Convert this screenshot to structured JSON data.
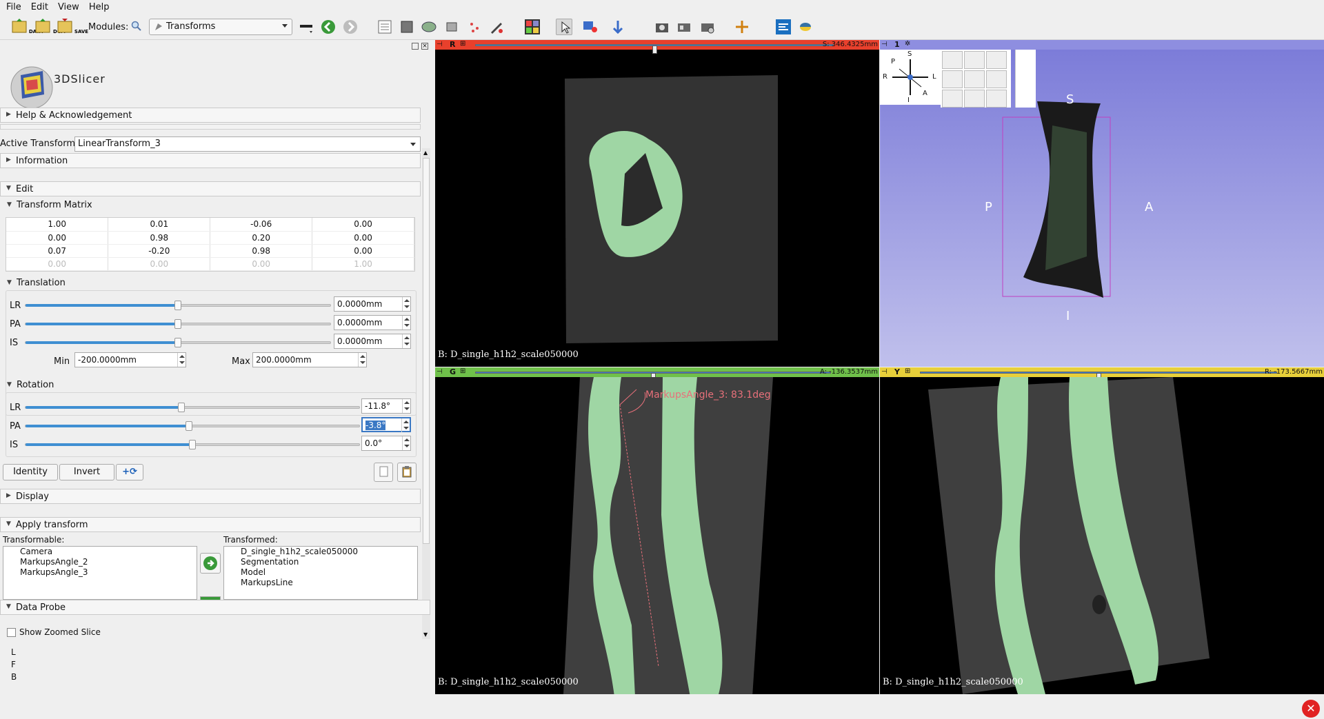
{
  "menubar": {
    "items": [
      "File",
      "Edit",
      "View",
      "Help"
    ]
  },
  "toolbar": {
    "data_label": "DATA",
    "dcm_label": "DCM",
    "save_label": "SAVE",
    "modules_label": "Modules:",
    "module_selected": "Transforms"
  },
  "panel": {
    "logo_text": "3DSlicer",
    "help_section": "Help & Acknowledgement",
    "active_transform_label": "Active Transform:",
    "active_transform_value": "LinearTransform_3",
    "information_section": "Information",
    "edit_section": "Edit",
    "transform_matrix_label": "Transform Matrix",
    "matrix": [
      [
        "1.00",
        "0.01",
        "-0.06",
        "0.00"
      ],
      [
        "0.00",
        "0.98",
        "0.20",
        "0.00"
      ],
      [
        "0.07",
        "-0.20",
        "0.98",
        "0.00"
      ],
      [
        "0.00",
        "0.00",
        "0.00",
        "1.00"
      ]
    ],
    "translation_label": "Translation",
    "translation": [
      {
        "axis": "LR",
        "value": "0.0000mm",
        "level": 0.5
      },
      {
        "axis": "PA",
        "value": "0.0000mm",
        "level": 0.5
      },
      {
        "axis": "IS",
        "value": "0.0000mm",
        "level": 0.5
      }
    ],
    "min_label": "Min",
    "min_value": "-200.0000mm",
    "max_label": "Max",
    "max_value": "200.0000mm",
    "rotation_label": "Rotation",
    "rotation": [
      {
        "axis": "LR",
        "value": "-11.8°",
        "level": 0.467
      },
      {
        "axis": "PA",
        "value": "-3.8°",
        "level": 0.489
      },
      {
        "axis": "IS",
        "value": "0.0°",
        "level": 0.5
      }
    ],
    "identity_button": "Identity",
    "invert_button": "Invert",
    "display_section": "Display",
    "apply_transform_section": "Apply transform",
    "transformable_label": "Transformable:",
    "transformable_items": [
      "Camera",
      "MarkupsAngle_2",
      "MarkupsAngle_3"
    ],
    "transformed_label": "Transformed:",
    "transformed_items": [
      "D_single_h1h2_scale050000",
      "Segmentation",
      "Model",
      "MarkupsLine"
    ],
    "data_probe_section": "Data Probe",
    "show_zoomed_slice": "Show Zoomed Slice",
    "probe_lines": [
      "L",
      "F",
      "B"
    ]
  },
  "views": {
    "red": {
      "letter": "R",
      "offset": "S: 346.4325mm",
      "label": "B: D_single_h1h2_scale050000",
      "color": "#e8402c",
      "level": 0.5
    },
    "threed": {
      "number": "1",
      "color": "#8e8ee0",
      "orient_p": "P",
      "orient_a": "A",
      "orient_i": "I",
      "orient_s": "S",
      "cube_s": "S",
      "cube_p": "P",
      "cube_r": "R",
      "cube_l": "L",
      "cube_a": "A",
      "cube_i": "I"
    },
    "green": {
      "letter": "G",
      "offset": "A: -136.3537mm",
      "label": "B: D_single_h1h2_scale050000",
      "annotation": "MarkupsAngle_3: 83.1deg",
      "color": "#6fc04a",
      "level": 0.5
    },
    "yellow": {
      "letter": "Y",
      "offset": "R: -173.5667mm",
      "label": "B: D_single_h1h2_scale050000",
      "color": "#e8d03a",
      "level": 0.5
    }
  },
  "colors": {
    "tissue": "#9fd6a4",
    "bone_gray": "#3f3f3f",
    "angle_annotation": "#e8707a",
    "bbox": "#c040c0"
  }
}
